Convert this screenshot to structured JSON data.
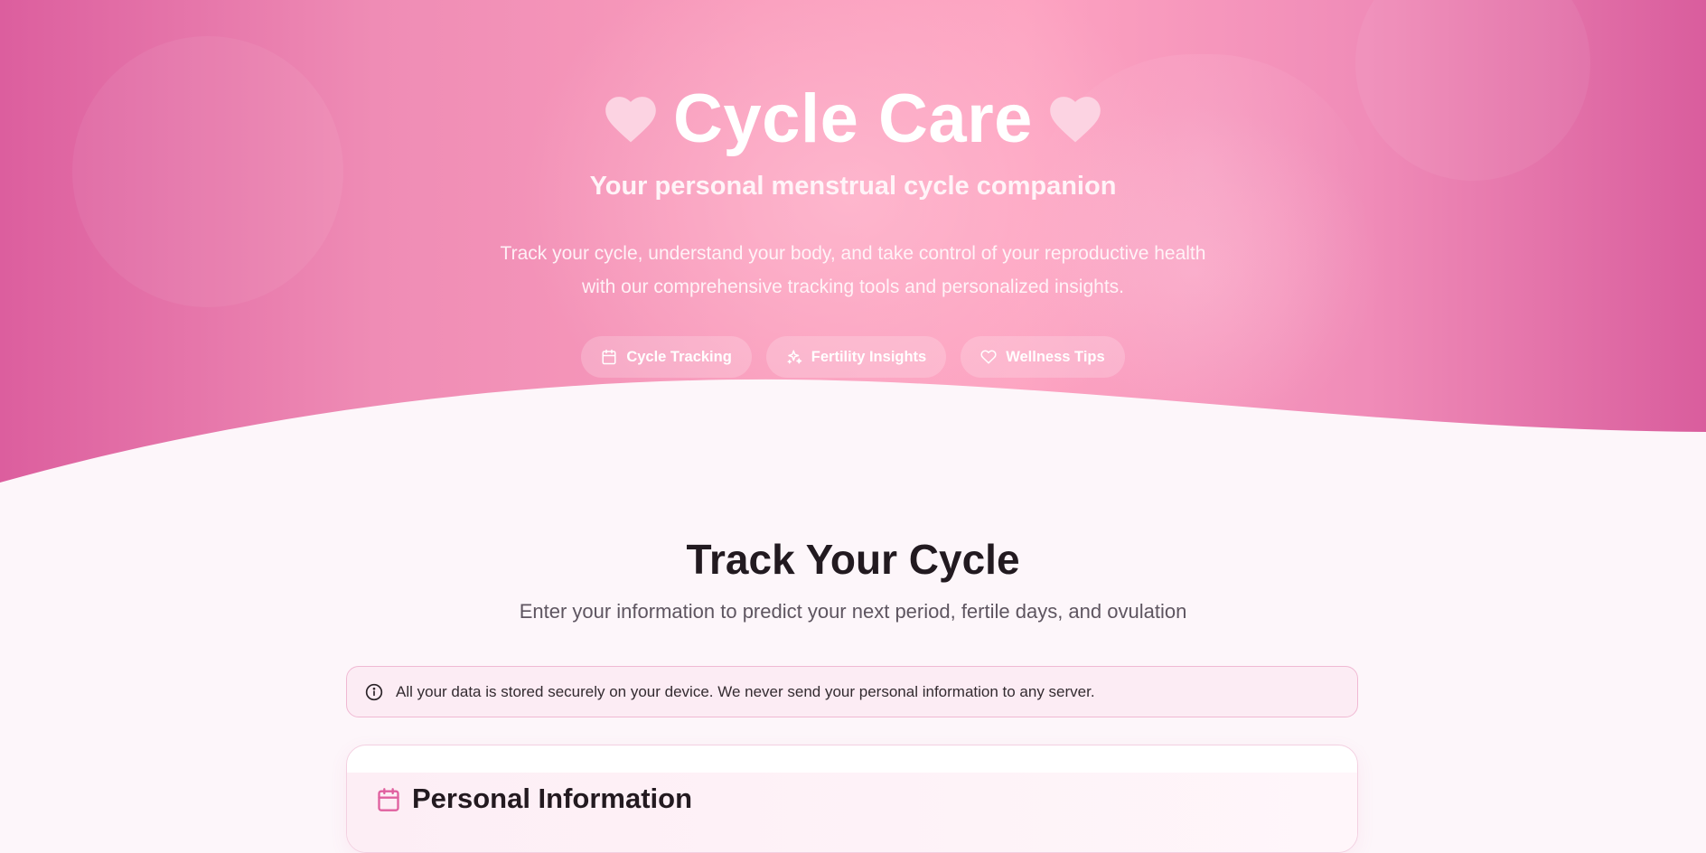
{
  "hero": {
    "title": "Cycle Care",
    "subtitle": "Your personal menstrual cycle companion",
    "description": "Track your cycle, understand your body, and take control of your reproductive health with our comprehensive tracking tools and personalized insights.",
    "pills": [
      {
        "label": "Cycle Tracking",
        "icon": "calendar-icon"
      },
      {
        "label": "Fertility Insights",
        "icon": "sparkles-icon"
      },
      {
        "label": "Wellness Tips",
        "icon": "heart-icon"
      }
    ]
  },
  "main": {
    "title": "Track Your Cycle",
    "subtitle": "Enter your information to predict your next period, fertile days, and ovulation",
    "notice": "All your data is stored securely on your device. We never send your personal information to any server.",
    "card_title": "Personal Information"
  },
  "colors": {
    "brand": "#e0609f",
    "hero_gradient_edge": "#d95d9d",
    "hero_gradient_center": "#fda3c1",
    "page_background": "#fdf6fa",
    "notice_border": "#f0b9d3",
    "notice_background": "#fcecf4"
  }
}
